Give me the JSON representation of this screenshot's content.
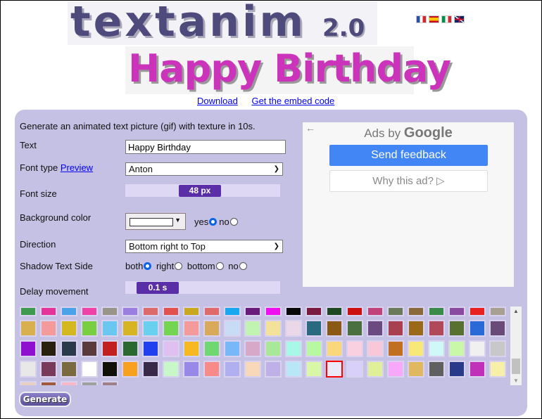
{
  "header": {
    "logo_text": "textanim",
    "logo_version": "2.0",
    "languages": [
      {
        "name": "flag-fr",
        "code": "fr"
      },
      {
        "name": "flag-es",
        "code": "es"
      },
      {
        "name": "flag-it",
        "code": "it"
      },
      {
        "name": "flag-uk",
        "code": "en"
      }
    ]
  },
  "preview": {
    "text": "Happy Birthday",
    "color": "#cc33bb"
  },
  "links": {
    "download": "Download",
    "embed": "Get the embed code"
  },
  "form": {
    "intro": "Generate an animated text picture (gif) with texture in 10s.",
    "text_label": "Text",
    "text_value": "Happy Birthday",
    "font_label": "Font type",
    "font_preview_link": "Preview",
    "font_value": "Anton",
    "fontsize_label": "Font size",
    "fontsize_value": "48 px",
    "bg_label": "Background color",
    "bg_color": "#ffffff",
    "bg_yes": "yes",
    "bg_no": "no",
    "bg_selected": "yes",
    "direction_label": "Direction",
    "direction_value": "Bottom right to Top",
    "shadow_label": "Shadow Text Side",
    "shadow_options": [
      "both",
      "right",
      "bottom",
      "no"
    ],
    "shadow_selected": "both",
    "delay_label": "Delay movement",
    "delay_value": "0.1 s",
    "generate_label": "Generate"
  },
  "ad": {
    "ads_by": "Ads by",
    "google": "Google",
    "send_feedback": "Send feedback",
    "why_this_ad": "Why this ad? ▷"
  },
  "textures": {
    "selected_index": 87,
    "colors": [
      "#3f9a4f",
      "#e6339a",
      "#4aa3e8",
      "#f041a8",
      "#99948a",
      "#9a7ee0",
      "#dd6a6a",
      "#e35050",
      "#c8a820",
      "#e06a6a",
      "#18a8f0",
      "#6a1a7a",
      "#ee10ee",
      "#080808",
      "#7a1a3e",
      "#1e4a22",
      "#cc1010",
      "#c2437a",
      "#6a7a5a",
      "#8a6a3a",
      "#3a8a4a",
      "#8a4aa0",
      "#e82020",
      "#a8a090",
      "#d9b050",
      "#f59a9a",
      "#d4b820",
      "#78d040",
      "#6ac8f0",
      "#d6b424",
      "#6ad0f0",
      "#74d650",
      "#f49a9a",
      "#d8aa5a",
      "#c8dcf6",
      "#c0f4b0",
      "#f4e29a",
      "#ead8e8",
      "#2a6a80",
      "#8a5a14",
      "#4a7040",
      "#6a4a80",
      "#a84050",
      "#9a6a18",
      "#b04a5a",
      "#587030",
      "#2a6ad8",
      "#6a4a78",
      "#9010d0",
      "#2a2010",
      "#2a3a4a",
      "#5a3a3a",
      "#c02020",
      "#2a6a30",
      "#2040f0",
      "#e0c0f0",
      "#f8b820",
      "#70d870",
      "#78b8f8",
      "#d8a8c8",
      "#a8e898",
      "#a8f8e8",
      "#b8f8a0",
      "#f8d878",
      "#f8d0e0",
      "#f8c8d8",
      "#c07020",
      "#f8e878",
      "#d0f8f8",
      "#c8f8a8",
      "#f0f0f0",
      "#c8c8c8",
      "#e8e8e8",
      "#7a3a5a",
      "#7a6a40",
      "#ffffff",
      "#101008",
      "#f8a020",
      "#3a2a4a",
      "#c8f8c8",
      "#9888e8",
      "#f88a8a",
      "#b0b0f0",
      "#f8d8b8",
      "#c0b0e8",
      "#b8e8f8",
      "#d8f8a8",
      "#e8e8f8",
      "#d8d0f8",
      "#e0f098",
      "#f8a8f8",
      "#e0b860",
      "#606060",
      "#2a3a8a",
      "#c030b8",
      "#f8f0a8",
      "#e8d0c0",
      "#a05a3a",
      "#f8b8c8",
      "#a0a0a0",
      "#a08088"
    ]
  }
}
